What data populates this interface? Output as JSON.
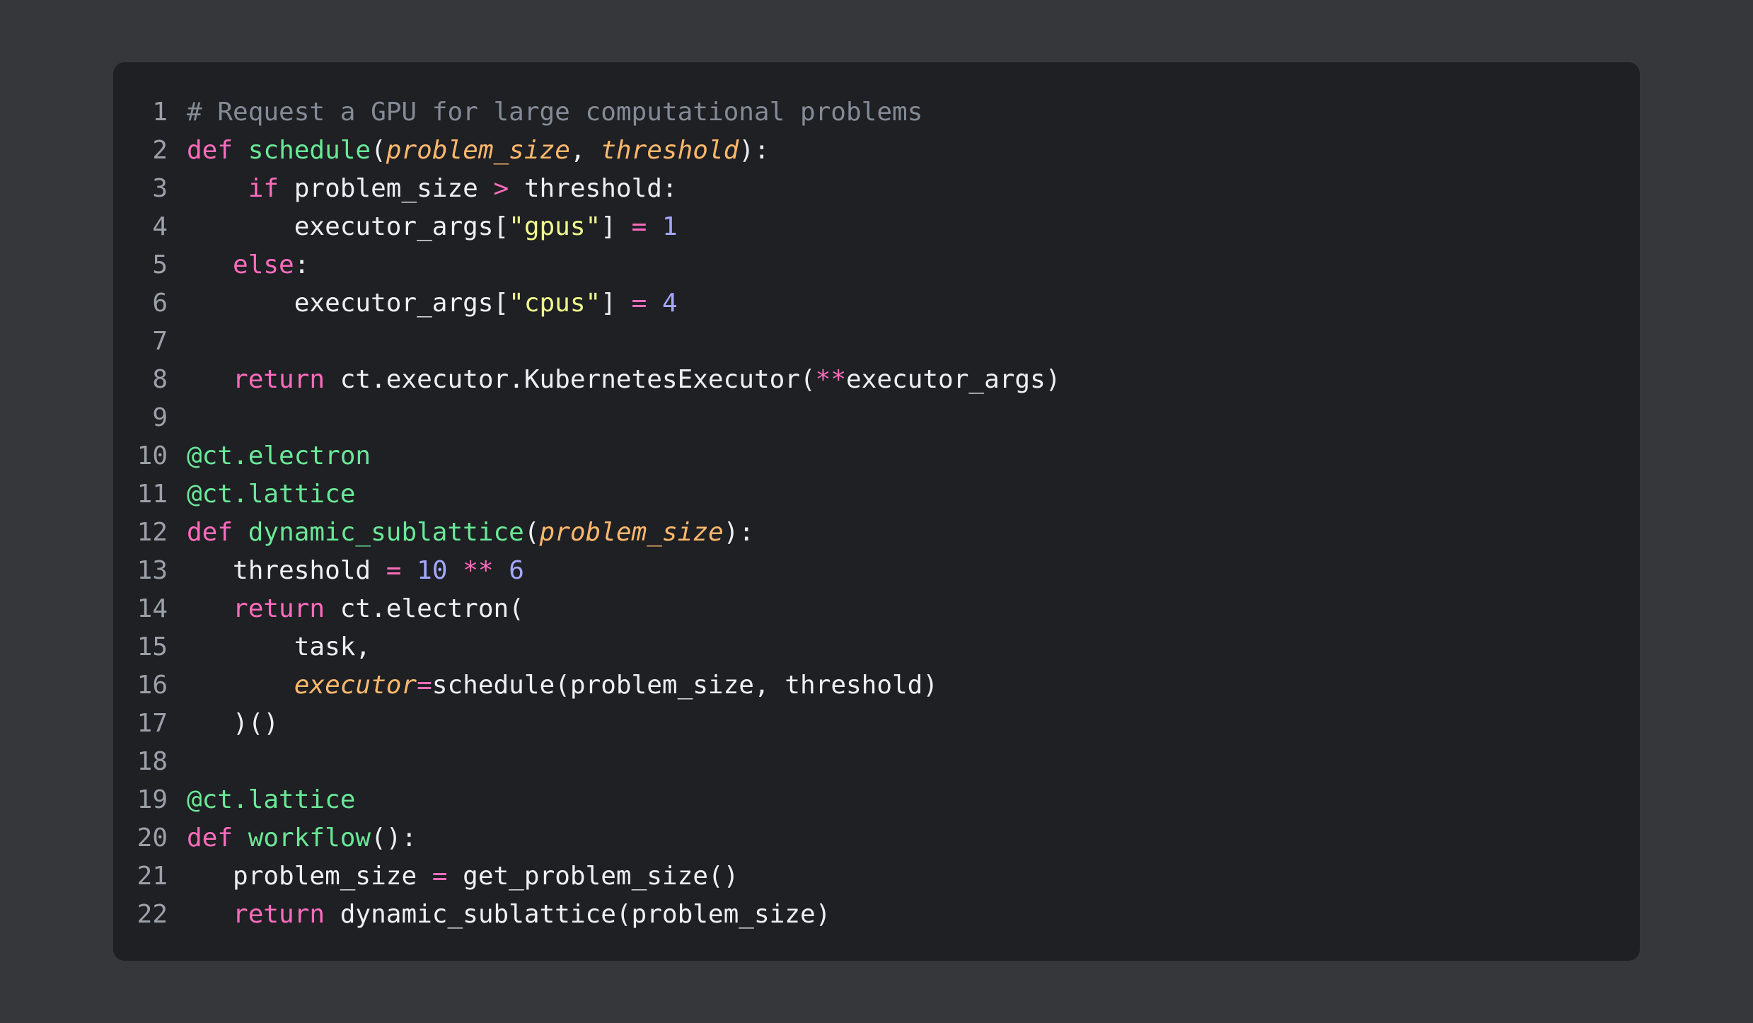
{
  "code_block": {
    "lines": [
      {
        "num": "1",
        "indent": "",
        "tokens": [
          {
            "t": "# Request a GPU for large computational problems",
            "c": "comment"
          }
        ]
      },
      {
        "num": "2",
        "indent": "",
        "tokens": [
          {
            "t": "def",
            "c": "keyword"
          },
          {
            "t": " ",
            "c": "plain"
          },
          {
            "t": "schedule",
            "c": "func"
          },
          {
            "t": "(",
            "c": "plain"
          },
          {
            "t": "problem_size",
            "c": "param"
          },
          {
            "t": ", ",
            "c": "plain"
          },
          {
            "t": "threshold",
            "c": "param"
          },
          {
            "t": "):",
            "c": "plain"
          }
        ]
      },
      {
        "num": "3",
        "indent": "    ",
        "tokens": [
          {
            "t": "if",
            "c": "keyword"
          },
          {
            "t": " problem_size ",
            "c": "plain"
          },
          {
            "t": ">",
            "c": "op"
          },
          {
            "t": " threshold:",
            "c": "plain"
          }
        ]
      },
      {
        "num": "4",
        "indent": "       ",
        "tokens": [
          {
            "t": "executor_args[",
            "c": "plain"
          },
          {
            "t": "\"gpus\"",
            "c": "string"
          },
          {
            "t": "] ",
            "c": "plain"
          },
          {
            "t": "=",
            "c": "op"
          },
          {
            "t": " ",
            "c": "plain"
          },
          {
            "t": "1",
            "c": "number"
          }
        ]
      },
      {
        "num": "5",
        "indent": "   ",
        "tokens": [
          {
            "t": "else",
            "c": "keyword"
          },
          {
            "t": ":",
            "c": "plain"
          }
        ]
      },
      {
        "num": "6",
        "indent": "       ",
        "tokens": [
          {
            "t": "executor_args[",
            "c": "plain"
          },
          {
            "t": "\"cpus\"",
            "c": "string"
          },
          {
            "t": "] ",
            "c": "plain"
          },
          {
            "t": "=",
            "c": "op"
          },
          {
            "t": " ",
            "c": "plain"
          },
          {
            "t": "4",
            "c": "number"
          }
        ]
      },
      {
        "num": "7",
        "indent": "",
        "tokens": []
      },
      {
        "num": "8",
        "indent": "   ",
        "tokens": [
          {
            "t": "return",
            "c": "keyword"
          },
          {
            "t": " ct.executor.KubernetesExecutor(",
            "c": "plain"
          },
          {
            "t": "**",
            "c": "op"
          },
          {
            "t": "executor_args)",
            "c": "plain"
          }
        ]
      },
      {
        "num": "9",
        "indent": "",
        "tokens": []
      },
      {
        "num": "10",
        "indent": "",
        "tokens": [
          {
            "t": "@ct.electron",
            "c": "decorator"
          }
        ]
      },
      {
        "num": "11",
        "indent": "",
        "tokens": [
          {
            "t": "@ct.lattice",
            "c": "decorator"
          }
        ]
      },
      {
        "num": "12",
        "indent": "",
        "tokens": [
          {
            "t": "def",
            "c": "keyword"
          },
          {
            "t": " ",
            "c": "plain"
          },
          {
            "t": "dynamic_sublattice",
            "c": "func"
          },
          {
            "t": "(",
            "c": "plain"
          },
          {
            "t": "problem_size",
            "c": "param"
          },
          {
            "t": "):",
            "c": "plain"
          }
        ]
      },
      {
        "num": "13",
        "indent": "   ",
        "tokens": [
          {
            "t": "threshold ",
            "c": "plain"
          },
          {
            "t": "=",
            "c": "op"
          },
          {
            "t": " ",
            "c": "plain"
          },
          {
            "t": "10",
            "c": "number"
          },
          {
            "t": " ",
            "c": "plain"
          },
          {
            "t": "**",
            "c": "op"
          },
          {
            "t": " ",
            "c": "plain"
          },
          {
            "t": "6",
            "c": "number"
          }
        ]
      },
      {
        "num": "14",
        "indent": "   ",
        "tokens": [
          {
            "t": "return",
            "c": "keyword"
          },
          {
            "t": " ct.electron(",
            "c": "plain"
          }
        ]
      },
      {
        "num": "15",
        "indent": "       ",
        "tokens": [
          {
            "t": "task,",
            "c": "plain"
          }
        ]
      },
      {
        "num": "16",
        "indent": "       ",
        "tokens": [
          {
            "t": "executor",
            "c": "param"
          },
          {
            "t": "=",
            "c": "op"
          },
          {
            "t": "schedule(problem_size, threshold)",
            "c": "plain"
          }
        ]
      },
      {
        "num": "17",
        "indent": "   ",
        "tokens": [
          {
            "t": ")()",
            "c": "plain"
          }
        ]
      },
      {
        "num": "18",
        "indent": "",
        "tokens": []
      },
      {
        "num": "19",
        "indent": "",
        "tokens": [
          {
            "t": "@ct.lattice",
            "c": "decorator"
          }
        ]
      },
      {
        "num": "20",
        "indent": "",
        "tokens": [
          {
            "t": "def",
            "c": "keyword"
          },
          {
            "t": " ",
            "c": "plain"
          },
          {
            "t": "workflow",
            "c": "func"
          },
          {
            "t": "():",
            "c": "plain"
          }
        ]
      },
      {
        "num": "21",
        "indent": "   ",
        "tokens": [
          {
            "t": "problem_size ",
            "c": "plain"
          },
          {
            "t": "=",
            "c": "op"
          },
          {
            "t": " get_problem_size()",
            "c": "plain"
          }
        ]
      },
      {
        "num": "22",
        "indent": "   ",
        "tokens": [
          {
            "t": "return",
            "c": "keyword"
          },
          {
            "t": " dynamic_sublattice(problem_size)",
            "c": "plain"
          }
        ]
      }
    ]
  }
}
